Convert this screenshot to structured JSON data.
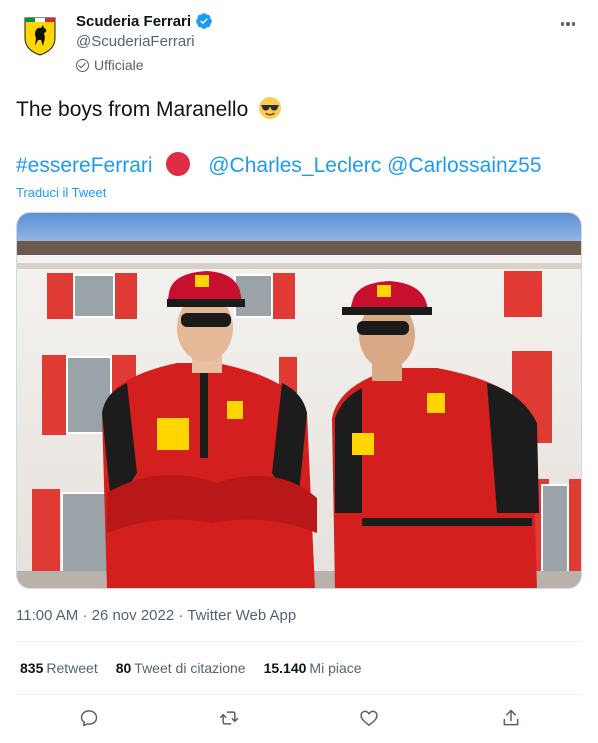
{
  "author": {
    "display_name": "Scuderia Ferrari",
    "handle": "@ScuderiaFerrari",
    "badge_label": "Ufficiale",
    "verified": true,
    "avatar_icon": "ferrari-prancing-horse-logo"
  },
  "tweet": {
    "text": "The boys from Maranello",
    "text_emoji": "smiling-face-with-sunglasses",
    "hashtag": "#essereFerrari",
    "hashtag_emoji": "red-circle",
    "mentions": [
      "@Charles_Leclerc",
      "@Carlossainz55"
    ],
    "translate_label": "Traduci il Tweet",
    "photo_description_icon": "photo-two-ferrari-drivers"
  },
  "meta": {
    "time": "11:00 AM",
    "date": "26 nov 2022",
    "source": "Twitter Web App",
    "separator": "·"
  },
  "stats": [
    {
      "value": "835",
      "label": "Retweet"
    },
    {
      "value": "80",
      "label": "Tweet di citazione"
    },
    {
      "value": "15.140",
      "label": "Mi piace"
    }
  ],
  "actions": [
    "reply-icon",
    "retweet-icon",
    "like-icon",
    "share-icon"
  ],
  "colors": {
    "link": "#1d9bf0",
    "secondary_text": "#536471",
    "primary_text": "#0f1419",
    "ferrari_red": "#d40000",
    "ferrari_yellow": "#ffd600"
  }
}
